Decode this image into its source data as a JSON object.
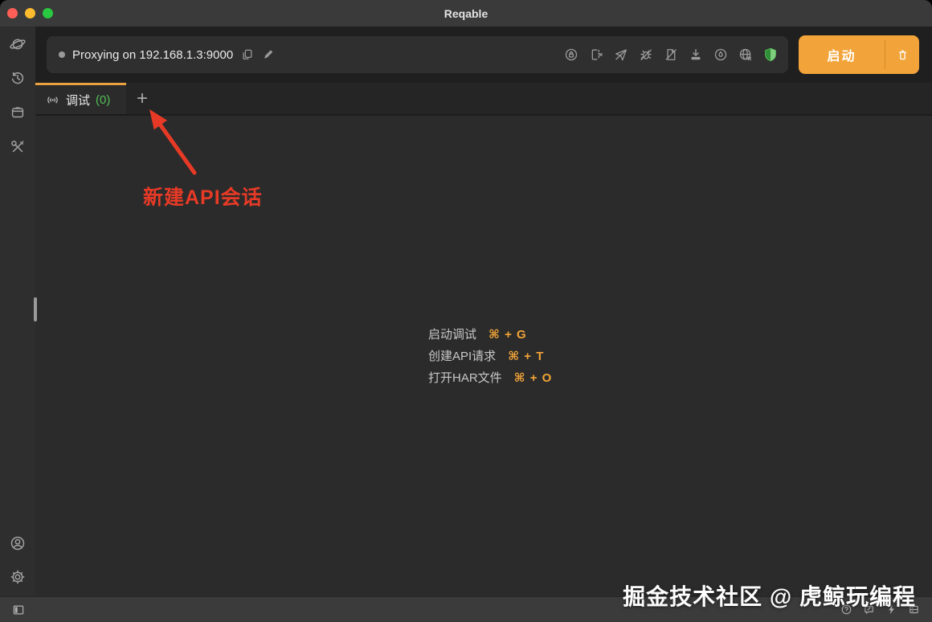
{
  "window": {
    "title": "Reqable"
  },
  "titlebar": {
    "traffic_lights": [
      "close",
      "minimize",
      "zoom"
    ]
  },
  "sidebar": {
    "top_icons": [
      "planet-icon",
      "history-icon",
      "collection-icon",
      "tools-icon"
    ],
    "bottom_icons": [
      "account-icon",
      "settings-icon"
    ]
  },
  "toolbar": {
    "proxy_status": "Proxying on 192.168.1.3:9000",
    "field_icons": [
      "copy-icon",
      "edit-pencil-icon"
    ],
    "action_icons": [
      "certificate-lock-icon",
      "device-disconnect-icon",
      "paper-plane-off-icon",
      "bug-off-icon",
      "script-off-icon",
      "download-icon",
      "drop-circle-icon",
      "network-off-icon",
      "ssl-shield-icon"
    ],
    "start_button": {
      "label": "启动",
      "device_icon": "phone-icon"
    }
  },
  "tabbar": {
    "active_tab": {
      "icon": "broadcast-icon",
      "label": "调试",
      "count": "(0)"
    },
    "add_tab_label": "+"
  },
  "annotation": {
    "label": "新建API会话",
    "color": "#e63a26"
  },
  "shortcuts": {
    "items": [
      {
        "label": "启动调试",
        "keys": "⌘ + G"
      },
      {
        "label": "创建API请求",
        "keys": "⌘ + T"
      },
      {
        "label": "打开HAR文件",
        "keys": "⌘ + O"
      }
    ]
  },
  "watermark": {
    "text": "掘金技术社区 @ 虎鲸玩编程"
  },
  "statusbar": {
    "left_icons": [
      "sidebar-toggle-icon"
    ],
    "right_icons": [
      "help-icon",
      "feedback-icon",
      "flash-icon",
      "console-icon"
    ]
  },
  "colors": {
    "accent_orange": "#f2a43a",
    "tab_border_orange": "#eba13f",
    "shortcut_key_orange": "#f2a437",
    "count_green": "#52c058",
    "shield_green": "#4caf50",
    "annotation_red": "#e63a26",
    "titlebar_bg": "#3a3a3a",
    "toolbar_bg": "#1f1f1f",
    "content_bg": "#2b2b2b",
    "statusbar_bg": "#3b3b3b"
  }
}
